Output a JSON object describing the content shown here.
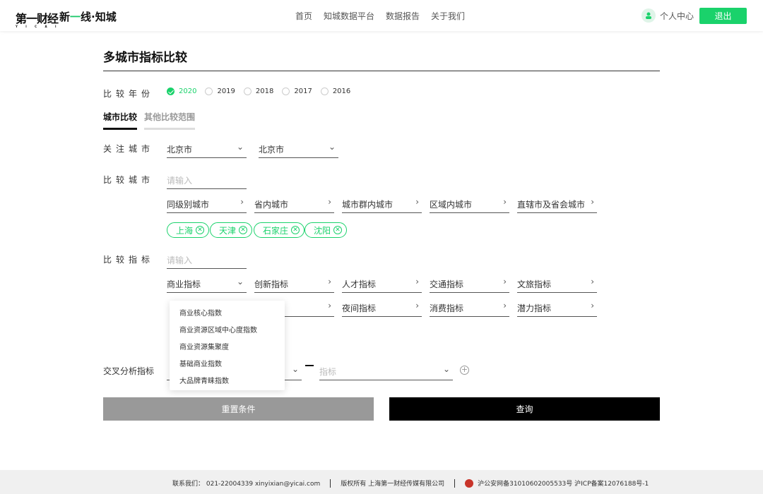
{
  "header": {
    "logo_primary": "第一财经",
    "logo_primary_sub": "Y I C A I",
    "logo_secondary_a": "新",
    "logo_secondary_b": "一",
    "logo_secondary_c": "线·知城",
    "nav": [
      "首页",
      "知城数据平台",
      "数据报告",
      "关于我们"
    ],
    "user_label": "个人中心",
    "logout_label": "退出"
  },
  "page_title": "多城市指标比较",
  "year_filter": {
    "label": "比较年份",
    "options": [
      "2020",
      "2019",
      "2018",
      "2017",
      "2016"
    ],
    "selected": "2020"
  },
  "tabs": [
    "城市比较",
    "其他比较范围"
  ],
  "focus_city": {
    "label": "关注城市",
    "values": [
      "北京市",
      "北京市"
    ]
  },
  "compare_city": {
    "label": "比较城市",
    "input_placeholder": "请输入",
    "groups": [
      "同级别城市",
      "省内城市",
      "城市群内城市",
      "区域内城市",
      "直辖市及省会城市"
    ],
    "chips": [
      "上海",
      "天津",
      "石家庄",
      "沈阳"
    ]
  },
  "compare_indicator": {
    "label": "比较指标",
    "input_placeholder": "请输入",
    "row1": [
      "商业指标",
      "创新指标",
      "人才指标",
      "交通指标",
      "文旅指标"
    ],
    "row2": [
      "夜间指标",
      "消费指标",
      "潜力指标"
    ],
    "dropdown": [
      "商业核心指数",
      "商业资源区域中心度指数",
      "商业资源集聚度",
      "基础商业指数",
      "大品牌青睐指数"
    ]
  },
  "cross_analysis": {
    "label": "交叉分析指标",
    "right_placeholder": "指标"
  },
  "buttons": {
    "reset": "重置条件",
    "query": "查询"
  },
  "footer": {
    "contact": "联系我们：  021-22004339 xinyixian@yicai.com",
    "copyright": "版权所有 上海第一财经传媒有限公司",
    "icp": "沪公安网备31010602005533号 沪ICP备案12076188号-1"
  }
}
